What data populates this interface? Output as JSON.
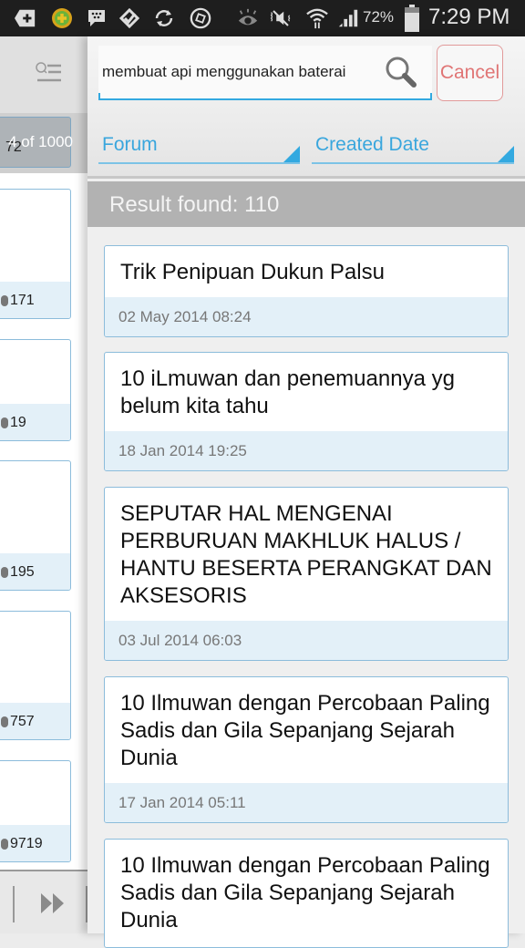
{
  "status_bar": {
    "icons": [
      "add-notification-icon",
      "security-app-icon",
      "bbm-icon",
      "foursquare-check-icon",
      "sync-icon",
      "shutter-icon",
      "smart-stay-eye-icon",
      "mute-icon",
      "wifi-icon",
      "signal-icon",
      "battery-icon"
    ],
    "battery_percent": "72%",
    "time": "7:29 PM"
  },
  "background_panel": {
    "page_indicator": "4 of 1000",
    "page_indicator_under": "72",
    "cards": [
      {
        "count": "171"
      },
      {
        "count": "19"
      },
      {
        "count": "195"
      },
      {
        "count": "757"
      },
      {
        "count": "9719"
      }
    ]
  },
  "search": {
    "query": "membuat api menggunakan baterai",
    "cancel_label": "Cancel"
  },
  "filters": {
    "forum_label": "Forum",
    "sort_label": "Created Date"
  },
  "results": {
    "summary": "Result found: 110",
    "items": [
      {
        "title": "Trik Penipuan Dukun Palsu",
        "date": "02 May 2014 08:24"
      },
      {
        "title": "10 iLmuwan dan penemuannya yg belum kita tahu",
        "date": "18 Jan 2014 19:25"
      },
      {
        "title": "SEPUTAR HAL MENGENAI PERBURUAN MAKHLUK HALUS / HANTU BESERTA PERANGKAT DAN AKSESORIS",
        "date": "03 Jul 2014 06:03"
      },
      {
        "title": "10 Ilmuwan dengan Percobaan Paling Sadis dan Gila Sepanjang Sejarah Dunia",
        "date": "17 Jan 2014 05:11"
      },
      {
        "title": "10 Ilmuwan dengan Percobaan Paling Sadis dan Gila Sepanjang Sejarah Dunia",
        "date": ""
      }
    ]
  }
}
